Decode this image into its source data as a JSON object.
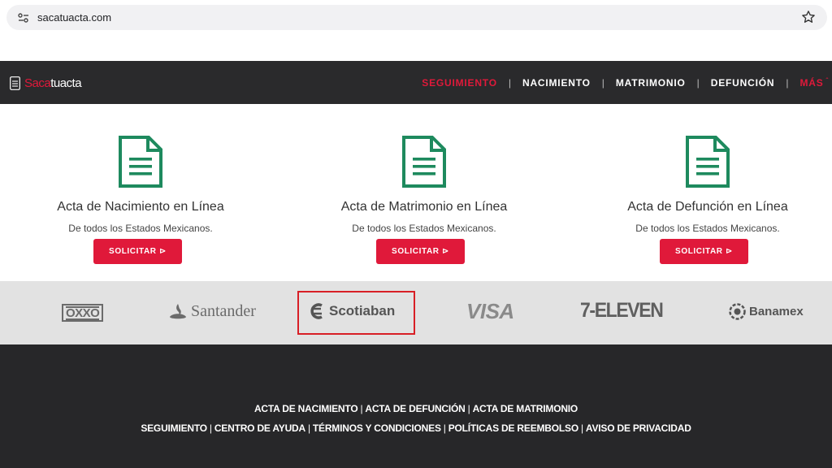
{
  "browser": {
    "url": "sacatuacta.com"
  },
  "nav": {
    "logo_part1": "Saca",
    "logo_part2": "tu",
    "logo_part3": "acta",
    "links": [
      {
        "label": "SEGUIMIENTO",
        "color": "#e0193a"
      },
      {
        "label": "NACIMIENTO",
        "color": "#ffffff"
      },
      {
        "label": "MATRIMONIO",
        "color": "#ffffff"
      },
      {
        "label": "DEFUNCIÓN",
        "color": "#ffffff"
      },
      {
        "label": "MÁS",
        "color": "#e0193a"
      }
    ],
    "separator": "|"
  },
  "cards": [
    {
      "title": "Acta de Nacimiento en Línea",
      "subtitle": "De todos los Estados Mexicanos.",
      "button": "SOLICITAR ⊳",
      "icon": "document-icon"
    },
    {
      "title": "Acta de Matrimonio en Línea",
      "subtitle": "De todos los Estados Mexicanos.",
      "button": "SOLICITAR ⊳",
      "icon": "document-icon"
    },
    {
      "title": "Acta de Defunción en Línea",
      "subtitle": "De todos los Estados Mexicanos.",
      "button": "SOLICITAR ⊳",
      "icon": "document-icon"
    }
  ],
  "payments": {
    "oxxo": "OXXO",
    "santander": "Santander",
    "scotiabank": "Scotiaban",
    "visa": "VISA",
    "seven_eleven": "7-ELEVEN",
    "banamex": "Banamex"
  },
  "footer": {
    "row1": [
      "ACTA DE NACIMIENTO",
      "ACTA DE DEFUNCIÓN",
      "ACTA DE MATRIMONIO"
    ],
    "row2": [
      "SEGUIMIENTO",
      "CENTRO DE AYUDA",
      "TÉRMINOS Y CONDICIONES",
      "POLÍTICAS DE REEMBOLSO",
      "AVISO DE PRIVACIDAD"
    ],
    "separator": "|"
  },
  "colors": {
    "accent_red": "#e0193a",
    "icon_green": "#1e8a5e",
    "nav_bg": "#2a2a2c",
    "footer_bg": "#272729",
    "strip_bg": "#e2e2e2"
  }
}
